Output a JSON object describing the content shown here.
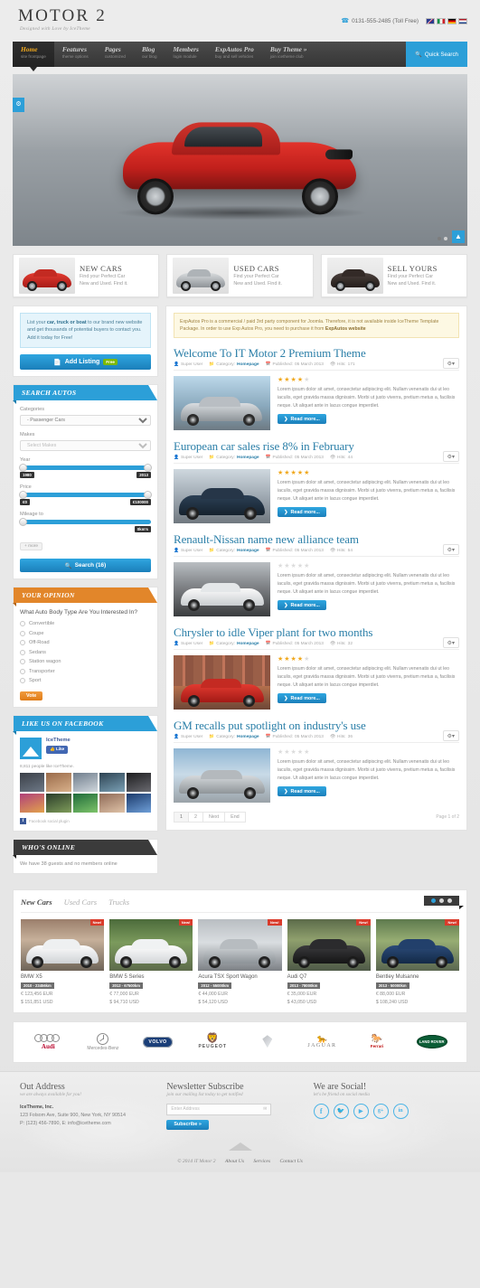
{
  "header": {
    "logo": "MOTOR 2",
    "tagline": "Designed with Love by IceTheme",
    "phone": "0131-555-2485 (Toll Free)",
    "phone_icon": "phone-icon",
    "flags": [
      "uk",
      "it",
      "de",
      "nl"
    ]
  },
  "nav": {
    "items": [
      {
        "label": "Home",
        "sub": "site frontpage"
      },
      {
        "label": "Features",
        "sub": "theme options"
      },
      {
        "label": "Pages",
        "sub": "customized"
      },
      {
        "label": "Blog",
        "sub": "our blog"
      },
      {
        "label": "Members",
        "sub": "login module"
      },
      {
        "label": "ExpAutos Pro",
        "sub": "buy and sell vehicles"
      },
      {
        "label": "Buy Theme »",
        "sub": "join icetheme club"
      }
    ],
    "quick_search": "Quick Search"
  },
  "slider": {
    "dots": 3,
    "active_dot": 1
  },
  "promos": [
    {
      "title": "NEW CARS",
      "line1": "Find your Perfect Car",
      "line2": "New and Used. Find it.",
      "color": "red"
    },
    {
      "title": "USED CARS",
      "line1": "Find your Perfect Car",
      "line2": "New and Used. Find it.",
      "color": "silver"
    },
    {
      "title": "SELL YOURS",
      "line1": "Find your Perfect Car",
      "line2": "New and Used. Find it.",
      "color": "black"
    }
  ],
  "sidebar": {
    "listing_promo": {
      "text_pre": "List your ",
      "text_bold": "car, truck or boat",
      "text_post": " to our brand new website and get thousands of potential buyers to contact you. Add it today for Free!",
      "button": "Add Listing",
      "badge": "Free"
    },
    "search": {
      "title": "SEARCH AUTOS",
      "categories_label": "Categories",
      "categories_value": "- Passenger Cars",
      "makes_label": "Makes",
      "makes_value": "Select Makes",
      "year_label": "Year",
      "year_min": "1980",
      "year_max": "2013",
      "price_label": "Price",
      "price_min": "€0",
      "price_max": "€100000",
      "mileage_label": "Mileage to",
      "mileage_max": "0km's",
      "more": "+ more",
      "search_button": "Search (16)"
    },
    "poll": {
      "title": "YOUR OPINION",
      "question": "What Auto Body Type Are You Interested In?",
      "options": [
        "Convertible",
        "Coupe",
        "Off-Road",
        "Sedans",
        "Station wagon",
        "Transporter",
        "Sport"
      ],
      "vote_button": "Vote"
    },
    "facebook": {
      "title": "LIKE US ON FACEBOOK",
      "page_name": "IceTheme",
      "like_button": "Like",
      "count_text": "8,811 people like IceTheme.",
      "footer_text": "Facebook social plugin"
    },
    "online": {
      "title": "WHO'S ONLINE",
      "text": "We have 38 guests and no members online"
    }
  },
  "content": {
    "alert": {
      "pre": "ExpAutos Pro is a commercial / paid 3rd party component for Joomla. Therefore, it is not available inside IceTheme Template Package. In order to use Exp Autos Pro, you need to purchase it from ",
      "link": "ExpAutos website"
    },
    "meta_labels": {
      "author": "Super User",
      "category_label": "Category:",
      "category": "Homepage",
      "published_label": "Published:",
      "published": "05 March 2013",
      "hits_label": "Hits:"
    },
    "body_text": "Lorem ipsum dolor sit amet, consectetur adipiscing elit. Nullam venenatis dui ut leo iaculis, eget gravida massa dignissim. Morbi ut justo viverra, pretium metus a, facilisis neque. Ut aliquet ante in lacus congue imperdiet.",
    "read_more": "Read more...",
    "articles": [
      {
        "title": "Welcome To IT Motor 2 Premium Theme",
        "hits": "171",
        "rating": 4,
        "img": "sedan-silver"
      },
      {
        "title": "European car sales rise 8% in February",
        "hits": "44",
        "rating": 5,
        "img": "sedan-blue"
      },
      {
        "title": "Renault-Nissan name new alliance team",
        "hits": "54",
        "rating": 0,
        "img": "coupe-white"
      },
      {
        "title": "Chrysler to idle Viper plant for two months",
        "hits": "32",
        "rating": 4,
        "img": "viper-red"
      },
      {
        "title": "GM recalls put spotlight on industry's use",
        "hits": "36",
        "rating": 0,
        "img": "sedan-grey"
      }
    ],
    "pagination": {
      "pages": [
        "1",
        "2",
        "Next",
        "End"
      ],
      "active": "1",
      "info": "Page 1 of 2"
    }
  },
  "cars_section": {
    "tabs": [
      "New Cars",
      "Used Cars",
      "Trucks"
    ],
    "active_tab": "New Cars",
    "new_tag": "New!",
    "dots": 3,
    "active_dot": 1,
    "cars": [
      {
        "name": "BMW X5",
        "km": "2010 - 23456km",
        "eur": "€ 123,456 EUR",
        "usd": "$ 151,851 USD",
        "tone": "white"
      },
      {
        "name": "BMW 5 Series",
        "km": "2012 - 67500km",
        "eur": "€ 77,000 EUR",
        "usd": "$ 94,710 USD",
        "tone": "white2"
      },
      {
        "name": "Acura TSX Sport Wagon",
        "km": "2012 - 55000km",
        "eur": "€ 44,000 EUR",
        "usd": "$ 54,120 USD",
        "tone": "silver"
      },
      {
        "name": "Audi Q7",
        "km": "2013 - 78000km",
        "eur": "€ 35,000 EUR",
        "usd": "$ 43,050 USD",
        "tone": "black"
      },
      {
        "name": "Bentley Mulsanne",
        "km": "2013 - 50000km",
        "eur": "€ 88,000 EUR",
        "usd": "$ 108,240 USD",
        "tone": "blue"
      }
    ]
  },
  "brands": [
    "Audi",
    "Mercedes-Benz",
    "VOLVO",
    "PEUGEOT",
    "Renault",
    "JAGUAR",
    "Ferrari",
    "LAND ROVER"
  ],
  "footer": {
    "address": {
      "title": "Out Address",
      "subtitle": "we are always available for you!",
      "company": "IceTheme, Inc.",
      "street": "123 Folsom Ave, Suite 900, New York, NY 90514",
      "contact": "P: (123) 456-7890, E: info@icetheme.com"
    },
    "newsletter": {
      "title": "Newsletter Subscribe",
      "subtitle": "join our mailing list today to get notified",
      "placeholder": "Enter Address",
      "button": "Subscribe »"
    },
    "social": {
      "title": "We are Social!",
      "subtitle": "let's be friend on social media",
      "icons": [
        "facebook-icon",
        "twitter-icon",
        "youtube-icon",
        "google-plus-icon",
        "linkedin-icon"
      ]
    },
    "copyright": "© 2014 iT Motor 2",
    "links": [
      "About Us",
      "Services",
      "Contact Us"
    ]
  }
}
